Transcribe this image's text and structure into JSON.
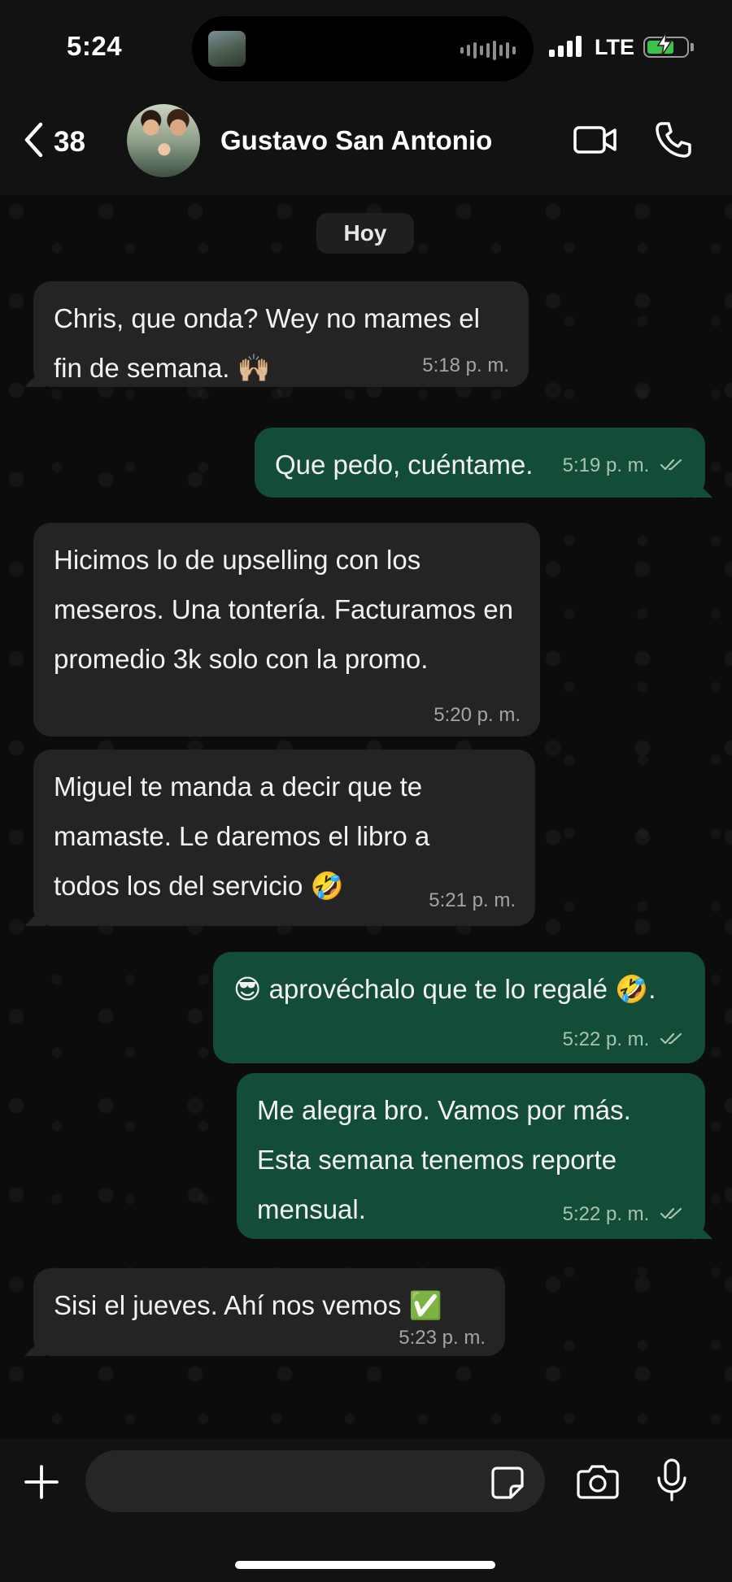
{
  "status_bar": {
    "time": "5:24",
    "network": "LTE",
    "battery_level": 0.7,
    "battery_charging": true
  },
  "header": {
    "back_count": "38",
    "contact_name": "Gustavo San Antonio",
    "icons": [
      "chevron-left-icon",
      "video-camera-icon",
      "phone-icon"
    ]
  },
  "chat": {
    "date_label": "Hoy",
    "messages": [
      {
        "direction": "in",
        "text": "Chris, que onda? Wey no mames el fin de semana. 🙌🏼",
        "time": "5:18 p. m."
      },
      {
        "direction": "out",
        "text": "Que pedo, cuéntame.",
        "time": "5:19 p. m.",
        "status": "read"
      },
      {
        "direction": "in",
        "text": "Hicimos lo de upselling con los meseros. Una tontería. Facturamos en promedio 3k solo con la promo.",
        "time": "5:20 p. m."
      },
      {
        "direction": "in",
        "text": "Miguel te manda a decir que te mamaste. Le daremos el libro a todos los del servicio 🤣",
        "time": "5:21 p. m."
      },
      {
        "direction": "out",
        "text": "😎 aprovéchalo que te lo regalé 🤣.",
        "time": "5:22 p. m.",
        "status": "read"
      },
      {
        "direction": "out",
        "text": "Me alegra bro. Vamos por más. Esta semana tenemos reporte mensual.",
        "time": "5:22 p. m.",
        "status": "read"
      },
      {
        "direction": "in",
        "text": "Sisi el jueves. Ahí nos vemos ✅",
        "time": "5:23 p. m."
      }
    ]
  },
  "input_bar": {
    "placeholder": "",
    "icons": [
      "plus-icon",
      "sticker-icon",
      "camera-icon",
      "microphone-icon"
    ]
  },
  "colors": {
    "incoming_bubble": "#242424",
    "outgoing_bubble": "#134d37",
    "background": "#0c0c0c",
    "bar": "#121212"
  }
}
